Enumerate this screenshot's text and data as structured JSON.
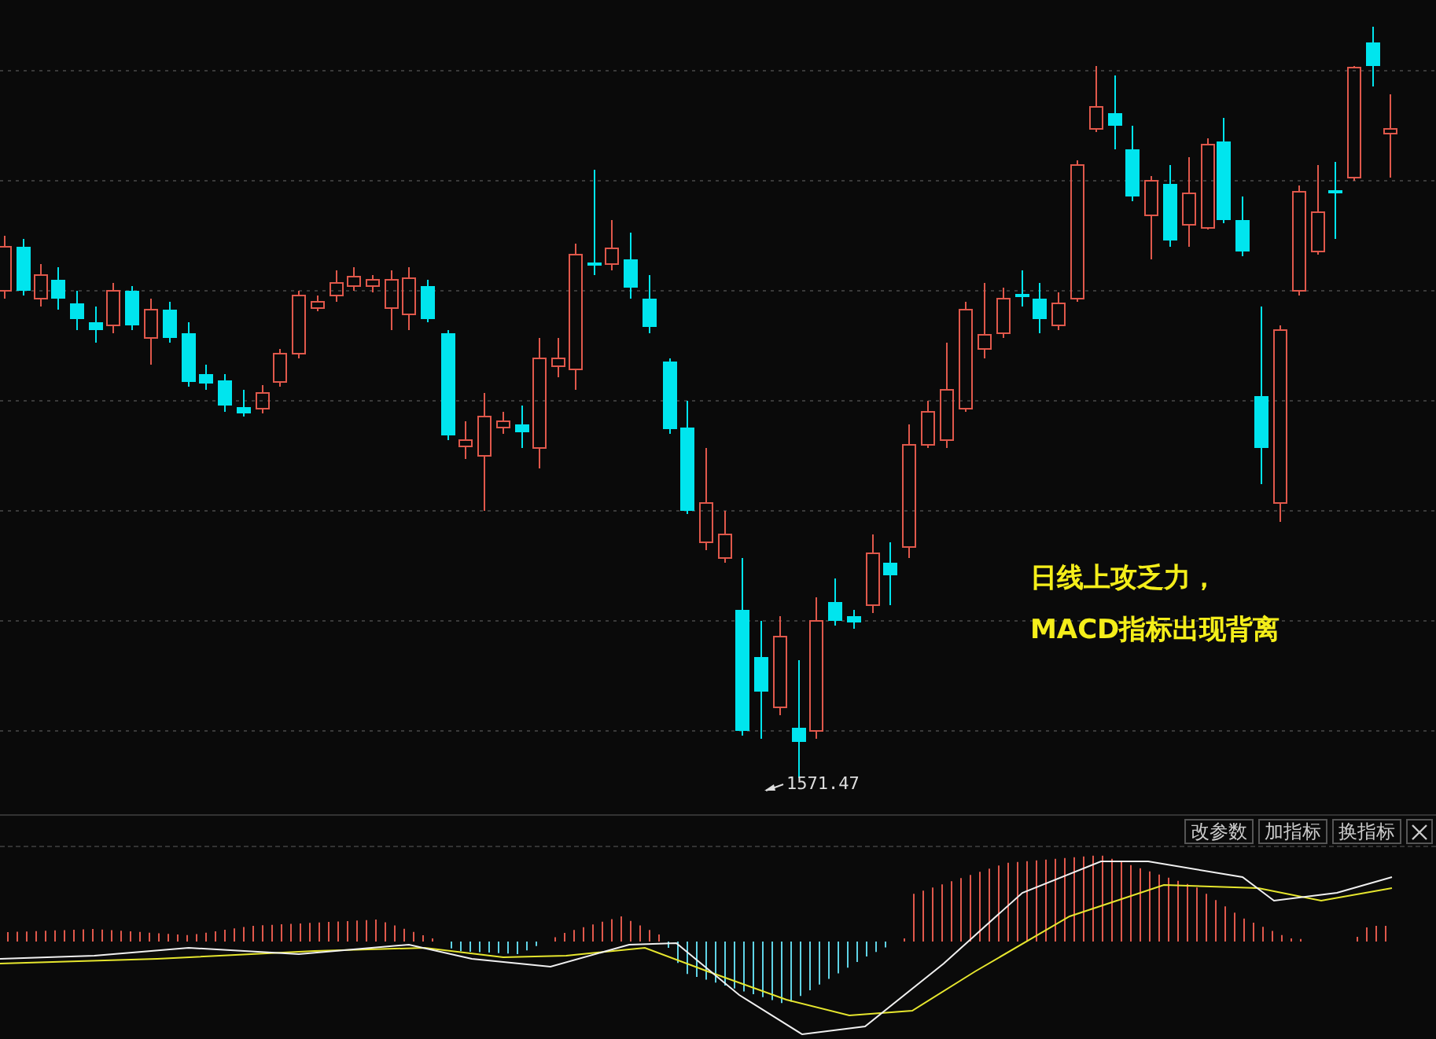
{
  "chart": {
    "low_label": "1571.47",
    "annotation": [
      "日线上攻乏力，",
      "MACD指标出现背离"
    ]
  },
  "indicator_panel": {
    "buttons": [
      "改参数",
      "加指标",
      "换指标"
    ]
  }
}
